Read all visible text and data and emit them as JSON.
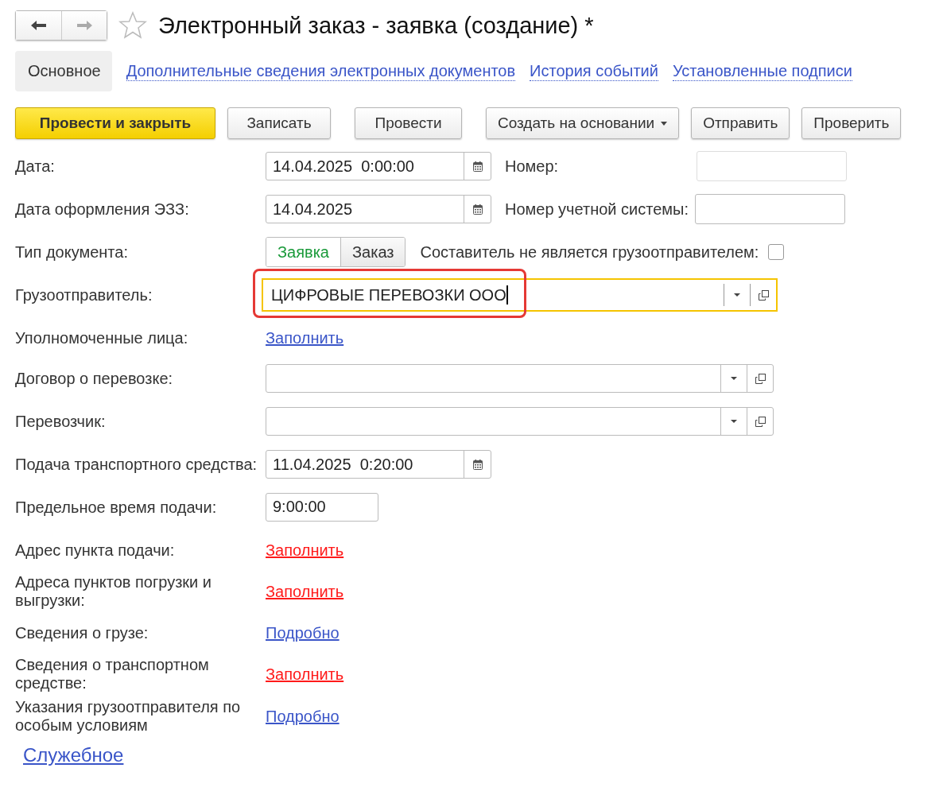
{
  "window": {
    "title": "Электронный заказ - заявка (создание) *",
    "favorite": false
  },
  "tabs": [
    {
      "label": "Основное",
      "selected": true
    },
    {
      "label": "Дополнительные сведения электронных документов",
      "selected": false
    },
    {
      "label": "История событий",
      "selected": false
    },
    {
      "label": "Установленные подписи",
      "selected": false
    }
  ],
  "buttons": [
    {
      "label": "Провести и закрыть",
      "kind": "primary"
    },
    {
      "label": "Записать",
      "kind": "normal"
    },
    {
      "label": "Провести",
      "kind": "normal"
    },
    {
      "label": "Создать на основании",
      "kind": "menu"
    },
    {
      "label": "Отправить",
      "kind": "normal"
    },
    {
      "label": "Проверить",
      "kind": "normal"
    }
  ],
  "rows": [
    {
      "kind": "date",
      "label": "Дата:",
      "value": "14.04.2025  0:00:00",
      "side": {
        "label": "Номер:",
        "disabled": true
      }
    },
    {
      "kind": "date",
      "label": "Дата оформления ЭЗЗ:",
      "value": "14.04.2025",
      "side": {
        "label": "Номер учетной системы:",
        "disabled": false
      }
    },
    {
      "kind": "switch",
      "label": "Тип документа:",
      "options": [
        {
          "label": "Заявка",
          "selected": true
        },
        {
          "label": "Заказ",
          "selected": false
        }
      ],
      "checkbox": {
        "label": "Составитель не является грузоотправителем:",
        "checked": false
      }
    },
    {
      "kind": "ref",
      "label": "Грузоотправитель:",
      "value": "ЦИФРОВЫЕ ПЕРЕВОЗКИ ООО",
      "focused": true,
      "highlighted": true
    },
    {
      "kind": "link",
      "label": "Уполномоченные лица:",
      "link": "Заполнить",
      "required": false
    },
    {
      "kind": "ref",
      "label": "Договор о перевозке:",
      "focused": false,
      "highlighted": false
    },
    {
      "kind": "ref",
      "label": "Перевозчик:",
      "focused": false,
      "highlighted": false
    },
    {
      "kind": "date",
      "label": "Подача транспортного средства:",
      "value": "11.04.2025  0:20:00"
    },
    {
      "kind": "time",
      "label": "Предельное время подачи:",
      "value": "9:00:00"
    },
    {
      "kind": "link",
      "label": "Адрес пункта подачи:",
      "link": "Заполнить",
      "required": true
    },
    {
      "kind": "link",
      "label": "Адреса пунктов погрузки и выгрузки:",
      "link": "Заполнить",
      "required": true
    },
    {
      "kind": "link",
      "label": "Сведения о грузе:",
      "link": "Подробно",
      "required": false
    },
    {
      "kind": "link",
      "label": "Сведения о транспортном средстве:",
      "link": "Заполнить",
      "required": true
    },
    {
      "kind": "link",
      "label": "Указания грузоотправителя по особым условиям",
      "link": "Подробно",
      "required": false
    }
  ],
  "footer_link": "Служебное"
}
